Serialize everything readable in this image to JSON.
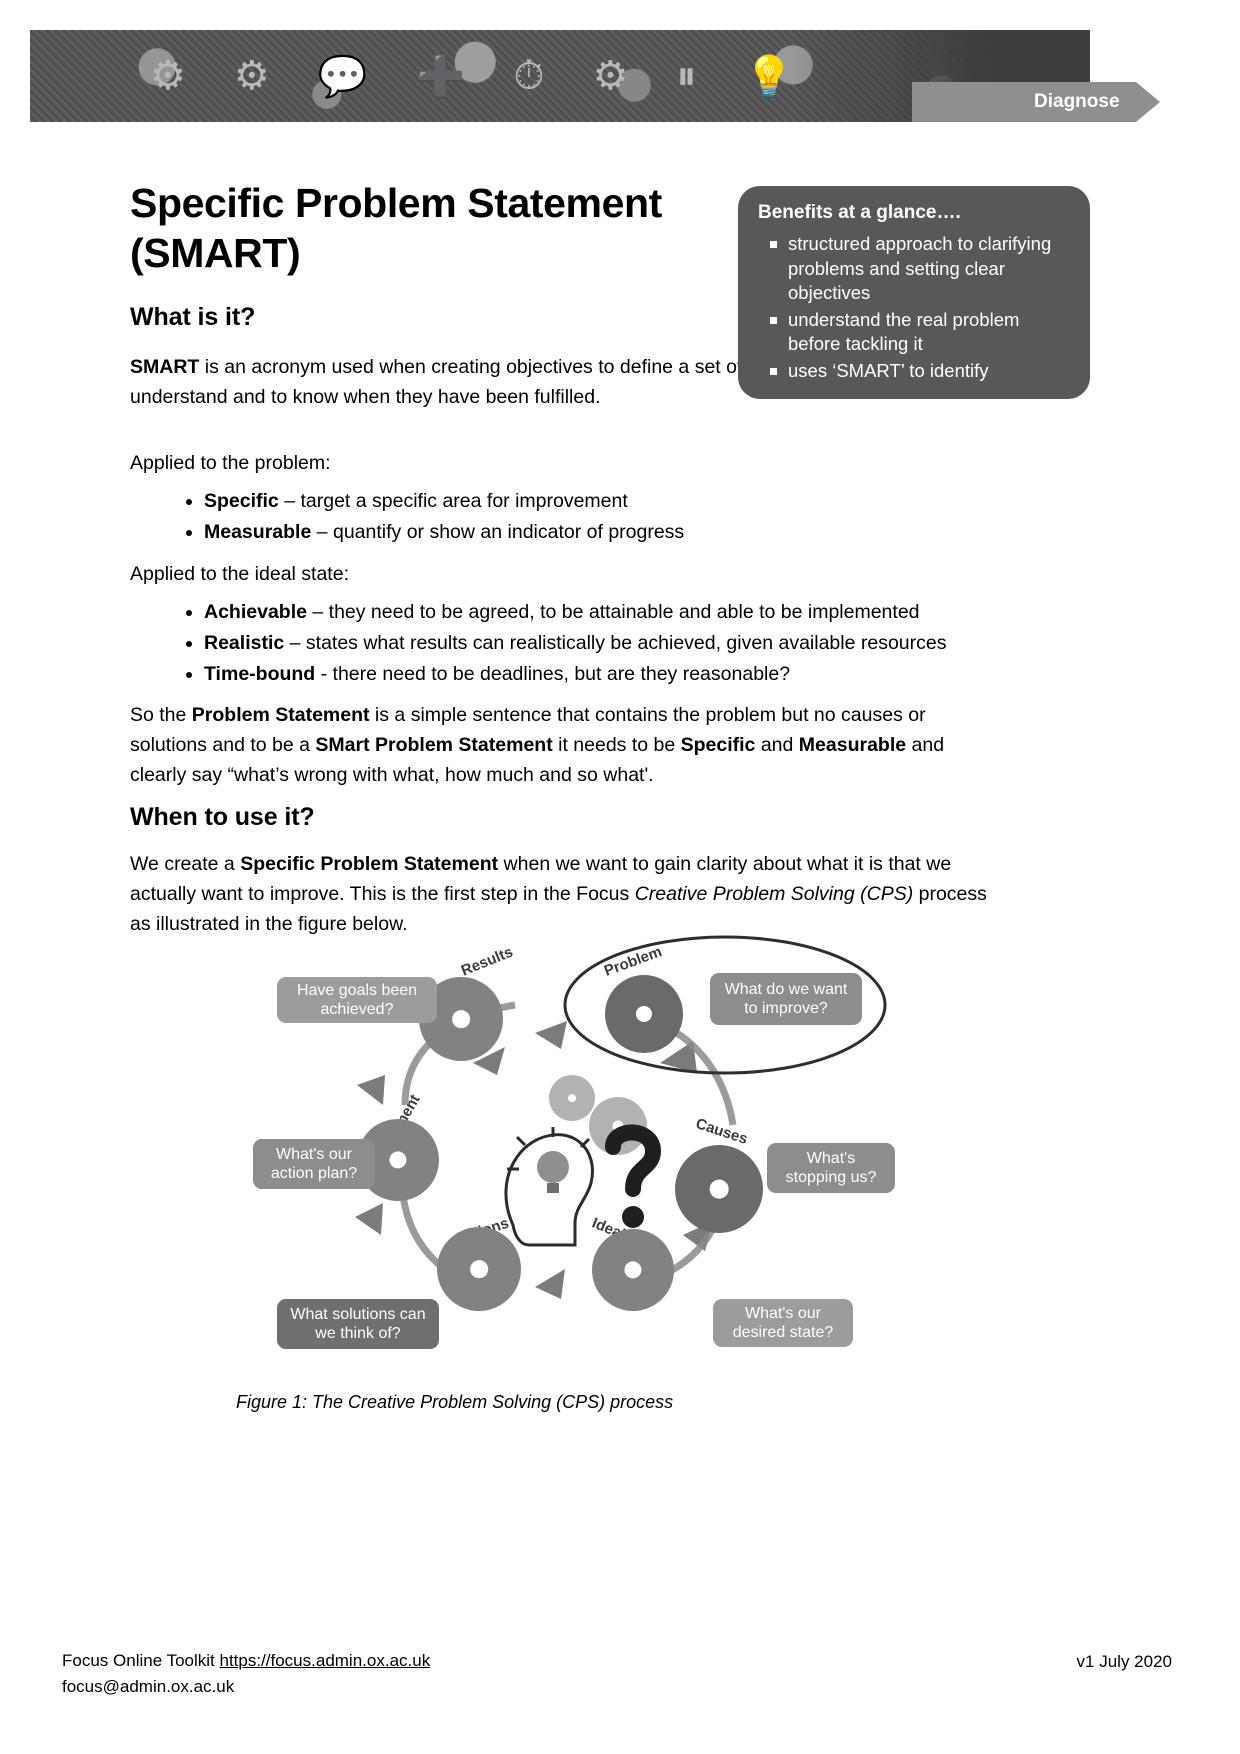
{
  "header": {
    "ribbon_label": "Diagnose",
    "banner_icons": [
      "gear-icon",
      "chat-icon",
      "plus-icon",
      "clock-icon",
      "pause-icon",
      "lightbulb-icon"
    ]
  },
  "document": {
    "title": "Specific Problem Statement (SMART)",
    "sections": {
      "what_is_it": {
        "heading": "What is it?",
        "intro_lead": "SMART",
        "intro_rest": " is an acronym used when creating objectives to define a set of criteria that are easy to understand and to know when they have been fulfilled.",
        "applied_problem_label": "Applied to the problem:",
        "problem_bullets": [
          {
            "term": "Specific",
            "desc": " – target a specific area for improvement"
          },
          {
            "term": "Measurable",
            "desc": " – quantify or show an indicator of progress"
          }
        ],
        "applied_ideal_label": "Applied to the ideal state:",
        "ideal_bullets": [
          {
            "term": "Achievable",
            "desc": " – they need to be agreed, to be attainable and able to be implemented"
          },
          {
            "term": "Realistic",
            "desc": " – states what results can realistically be achieved, given available resources"
          },
          {
            "term": "Time-bound",
            "desc": " - there need to be deadlines, but are they reasonable?"
          }
        ],
        "summary": {
          "p1": "So the ",
          "b1": "Problem Statement",
          "p2": " is a simple sentence that contains the problem but no causes or solutions and to be a ",
          "b2": "SMart Problem Statement",
          "p3": " it needs to be ",
          "b3": "Specific",
          "p4": " and ",
          "b4": "Measurable",
          "p5": " and clearly say “what’s wrong with what, how much and so what'."
        }
      },
      "when_to_use_it": {
        "heading": "When to use it?",
        "p1": "We create a ",
        "b1": "Specific Problem Statement",
        "p2": " when we want to gain clarity about what it is that we actually want to improve. This is the first step in the Focus ",
        "i1": "Creative Problem Solving (CPS)",
        "p3": " process as illustrated in the figure below."
      }
    }
  },
  "benefits": {
    "title": "Benefits at a glance….",
    "items": [
      "structured approach to clarifying problems and setting clear objectives",
      "understand the real problem before tackling it",
      "uses ‘SMART’ to identify"
    ]
  },
  "figure": {
    "caption": "Figure 1: The Creative Problem Solving (CPS) process",
    "stage_labels": [
      "Results",
      "Problem",
      "Causes",
      "Ideal State",
      "Options",
      "Implement"
    ],
    "boxes": [
      {
        "id": "results",
        "text": "Have goals been achieved?"
      },
      {
        "id": "problem",
        "text": "What do we want to improve?"
      },
      {
        "id": "causes",
        "text": "What's stopping us?"
      },
      {
        "id": "ideal-state",
        "text": "What's our desired state?"
      },
      {
        "id": "options",
        "text": "What solutions can we think of?"
      },
      {
        "id": "implement",
        "text": "What's our action plan?"
      }
    ],
    "center_icon": "head-lightbulb-question-icon",
    "highlight": "problem-stage-ellipse"
  },
  "footer": {
    "toolkit_label": "Focus Online Toolkit ",
    "toolkit_url": "https://focus.admin.ox.ac.uk",
    "email": "focus@admin.ox.ac.uk",
    "version": "v1 July 2020"
  },
  "colors": {
    "banner": "#555555",
    "ribbon": "#8f8f8f",
    "benefits_box": "#585858",
    "figure_box": "#8d8d8d",
    "text": "#000000"
  }
}
